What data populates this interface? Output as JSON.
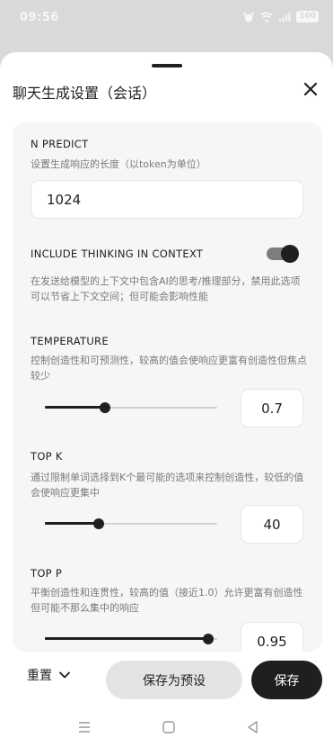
{
  "status": {
    "time": "09:56",
    "battery": "100"
  },
  "sheet": {
    "title": "聊天生成设置（会话）"
  },
  "settings": {
    "n_predict": {
      "label": "N PREDICT",
      "desc": "设置生成响应的长度（以token为单位）",
      "value": "1024"
    },
    "thinking": {
      "label": "INCLUDE THINKING IN CONTEXT",
      "desc": "在发送给模型的上下文中包含AI的思考/推理部分，禁用此选项可以节省上下文空间；但可能会影响性能",
      "enabled": true
    },
    "temperature": {
      "label": "TEMPERATURE",
      "desc": "控制创造性和可预测性，较高的值会使响应更富有创造性但焦点较少",
      "value": "0.7",
      "level": 0.35
    },
    "top_k": {
      "label": "TOP K",
      "desc": "通过限制单词选择到K个最可能的选项来控制创造性，较低的值会使响应更集中",
      "value": "40",
      "level": 0.31
    },
    "top_p": {
      "label": "TOP P",
      "desc": "平衡创造性和连贯性，较高的值（接近1.0）允许更富有创造性但可能不那么集中的响应",
      "value": "0.95",
      "level": 0.95
    }
  },
  "actions": {
    "reset": "重置",
    "save_preset": "保存为预设",
    "save": "保存"
  },
  "icons": {
    "close": "close-icon",
    "chevron": "chevron-down-icon",
    "nav_menu": "menu-icon",
    "nav_home": "home-icon",
    "nav_back": "back-icon"
  }
}
